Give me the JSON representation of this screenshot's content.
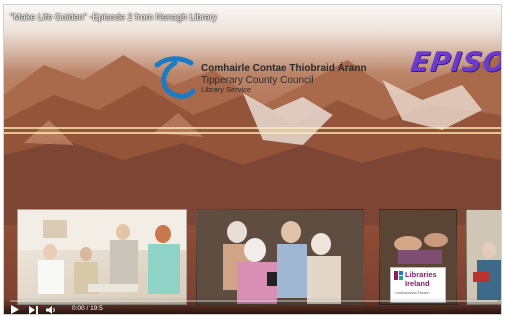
{
  "video": {
    "title": "\"Make Life Golden\" -Episode 2 from Nenagh Library",
    "time_display": "0:00 / 19:5"
  },
  "council": {
    "irish_name": "Comhairle Contae Thiobraid Árann",
    "english_name": "Tipperary County Council",
    "service": "Library Service"
  },
  "banner": {
    "episode_text": "EPISODE"
  },
  "libraries_badge": {
    "line1": "Libraries",
    "line2": "Ireland",
    "subtitle": "Leabharlanna Éireann"
  },
  "player": {
    "progress": 0.0,
    "icons": [
      "play-icon",
      "next-icon",
      "volume-icon"
    ]
  },
  "colors": {
    "episode": "#6c3ccf",
    "logo": "#1b7bc4",
    "progress": "#ff0000",
    "libraries": "#8a1c6b"
  }
}
